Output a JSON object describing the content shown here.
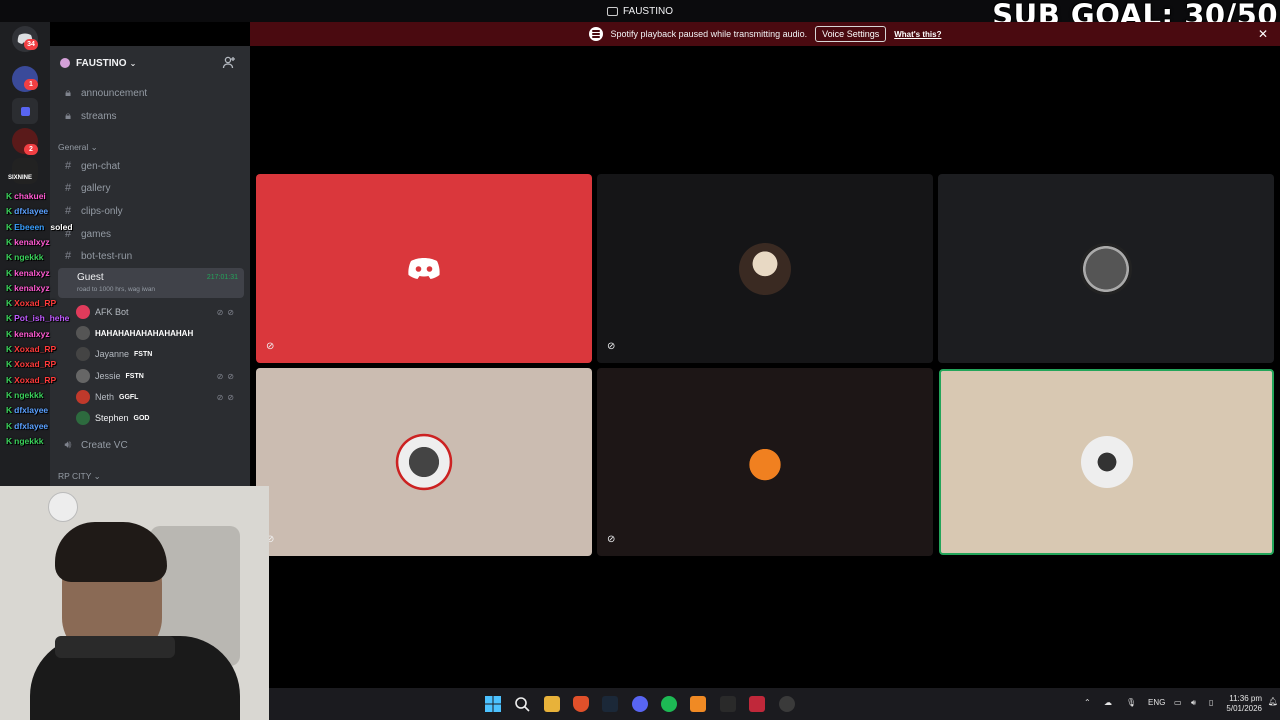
{
  "window": {
    "title": "FAUSTINO"
  },
  "overlay": {
    "sub_goal": "SUB GOAL: 30/50"
  },
  "notice": {
    "message": "Spotify playback paused while transmitting audio.",
    "button_label": "Voice Settings",
    "link_label": "What's this?"
  },
  "rail": {
    "badges": [
      "34",
      "1",
      "2"
    ],
    "server_label": "SIXNINE"
  },
  "server": {
    "name": "FAUSTINO",
    "channels_top": [
      {
        "label": "announcement",
        "icon": "lock-icon"
      },
      {
        "label": "streams",
        "icon": "lock-icon"
      }
    ],
    "category_general": "General",
    "channels_general": [
      {
        "label": "gen-chat",
        "icon": "hash-icon"
      },
      {
        "label": "gallery",
        "icon": "hash-icon"
      },
      {
        "label": "clips-only",
        "icon": "hash-icon"
      },
      {
        "label": "games",
        "icon": "hash-icon"
      },
      {
        "label": "bot-test-run",
        "icon": "hash-icon"
      }
    ],
    "voice_channel": {
      "name": "Guest",
      "status": "road to 1000 hrs, wag iwan",
      "timer": "217:01:31"
    },
    "voice_users": [
      {
        "name": "AFK Bot",
        "tag": ""
      },
      {
        "name": "HAHAHAHAHAHAHAHAH",
        "tag": ""
      },
      {
        "name": "Jayanne",
        "tag": "FSTN"
      },
      {
        "name": "Jessie",
        "tag": "FSTN"
      },
      {
        "name": "Neth",
        "tag": "GGFL"
      },
      {
        "name": "Stephen",
        "tag": "GOD"
      }
    ],
    "create_vc": "Create VC",
    "category_rp": "RP CITY"
  },
  "chat_overlay": [
    {
      "user": "chakuei",
      "color": "#ff5ad2"
    },
    {
      "user": "dfxlayee",
      "color": "#5aa0ff"
    },
    {
      "user": "Ebeeen",
      "color": "#3aa0ff",
      "msg": "soled"
    },
    {
      "user": "kenalxyz",
      "color": "#ff5ad2"
    },
    {
      "user": "ngekkk",
      "color": "#3ad15a"
    },
    {
      "user": "kenalxyz",
      "color": "#ff5ad2"
    },
    {
      "user": "kenalxyz",
      "color": "#ff5ad2"
    },
    {
      "user": "Xoxad_RP",
      "color": "#ff3a3a"
    },
    {
      "user": "Pot_ish_hehe",
      "color": "#c05aff"
    },
    {
      "user": "kenalxyz",
      "color": "#ff5ad2"
    },
    {
      "user": "Xoxad_RP",
      "color": "#ff3a3a"
    },
    {
      "user": "Xoxad_RP",
      "color": "#ff3a3a"
    },
    {
      "user": "Xoxad_RP",
      "color": "#ff3a3a"
    },
    {
      "user": "ngekkk",
      "color": "#3ad15a"
    },
    {
      "user": "dfxlayee",
      "color": "#5aa0ff"
    },
    {
      "user": "dfxlayee",
      "color": "#5aa0ff"
    },
    {
      "user": "ngekkk",
      "color": "#3ad15a"
    }
  ],
  "taskbar": {
    "lang": "ENG",
    "time": "11:36 pm",
    "date": "5/01/2026"
  }
}
